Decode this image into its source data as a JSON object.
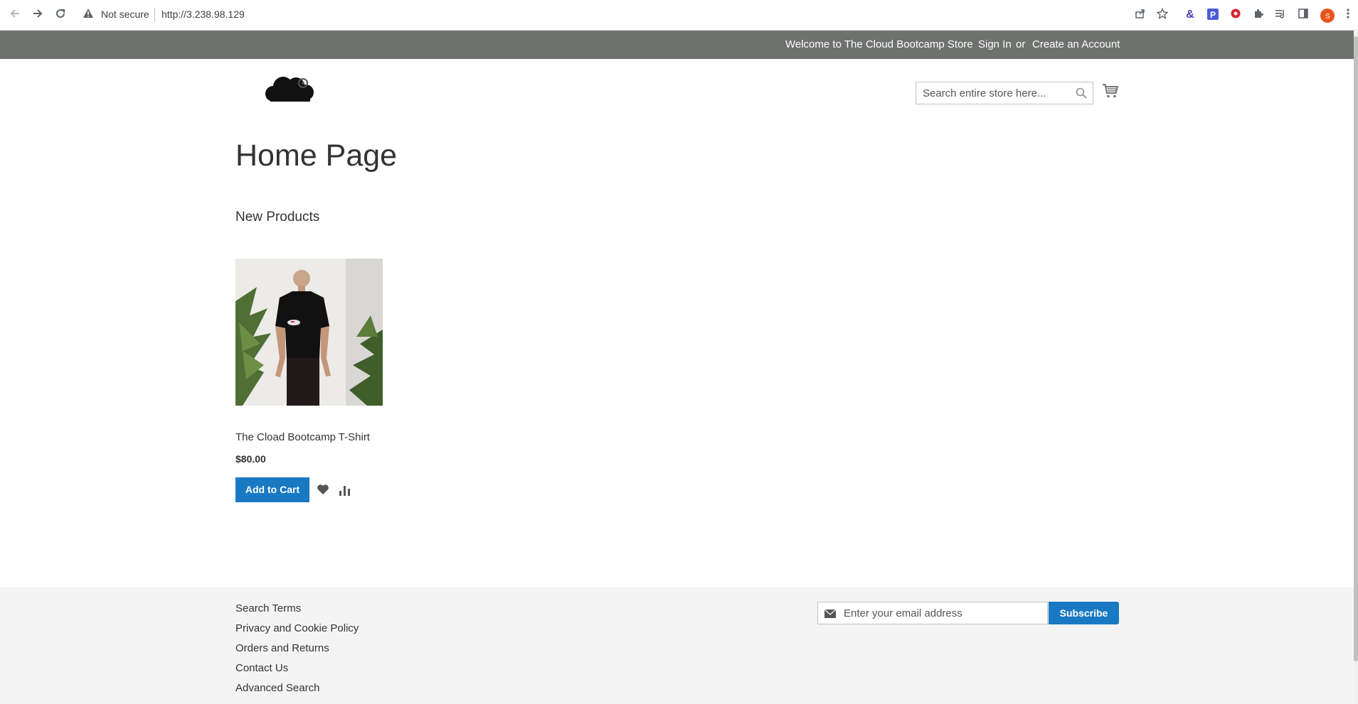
{
  "browser": {
    "security_label": "Not secure",
    "url": "http://3.238.98.129",
    "back_icon": "arrow-left-icon",
    "forward_icon": "arrow-right-icon",
    "reload_icon": "reload-icon",
    "profile_initial": "S"
  },
  "panel": {
    "welcome": "Welcome to The Cloud Bootcamp Store",
    "sign_in": "Sign In",
    "or": "or",
    "create_account": "Create an Account"
  },
  "header": {
    "search_placeholder": "Search entire store here...",
    "logo_icon": "cloud-bootcamp-logo",
    "cart_icon": "cart-icon"
  },
  "main": {
    "page_title": "Home Page",
    "section_title": "New Products",
    "products": [
      {
        "name": "The Cload Bootcamp T-Shirt",
        "price": "$80.00",
        "add_to_cart": "Add to Cart"
      }
    ]
  },
  "footer": {
    "links": [
      "Search Terms",
      "Privacy and Cookie Policy",
      "Orders and Returns",
      "Contact Us",
      "Advanced Search"
    ],
    "newsletter_placeholder": "Enter your email address",
    "subscribe": "Subscribe"
  },
  "colors": {
    "panel_bg": "#6e716e",
    "primary_button": "#1979c3",
    "footer_bg": "#f4f4f4",
    "profile_avatar": "#e8541d"
  }
}
